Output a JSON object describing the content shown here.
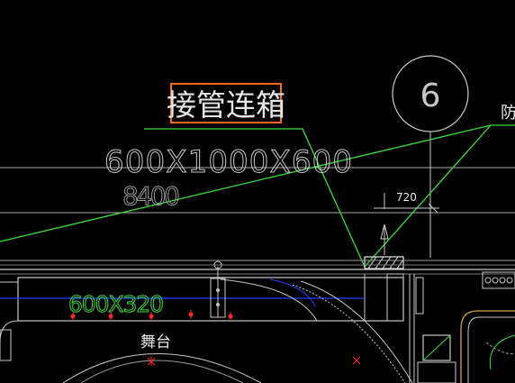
{
  "drawing": {
    "highlight_label": "接管连箱",
    "box_dims": "600X1000X600",
    "elevation": "8400",
    "axis_bubble": "6",
    "edge_label": "防",
    "dim_720": "720",
    "duct_size": "600X320",
    "room_label": "舞台"
  },
  "colors": {
    "background": "#000000",
    "line_white": "#c8c8c8",
    "line_green": "#3cdc3c",
    "line_blue": "#2a3cff",
    "line_red": "#ff2a2a",
    "highlight_box": "#ff6a1a",
    "text_white": "#e6e6e6",
    "text_green": "#3cdc3c"
  }
}
